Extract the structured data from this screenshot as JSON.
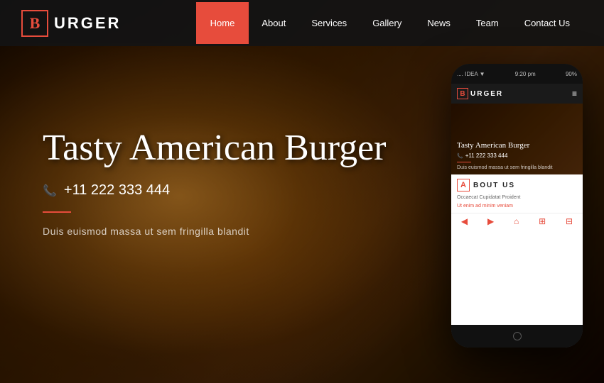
{
  "brand": {
    "letter": "B",
    "name": "URGER",
    "full_name": "BURGER"
  },
  "navbar": {
    "items": [
      {
        "label": "Home",
        "active": true
      },
      {
        "label": "About",
        "active": false
      },
      {
        "label": "Services",
        "active": false
      },
      {
        "label": "Gallery",
        "active": false
      },
      {
        "label": "News",
        "active": false
      },
      {
        "label": "Team",
        "active": false
      },
      {
        "label": "Contact Us",
        "active": false
      }
    ]
  },
  "hero": {
    "title": "Tasty American Burger",
    "phone_icon": "📞",
    "phone_number": "+11 222 333 444",
    "subtitle": "Duis euismod massa ut sem fringilla blandit"
  },
  "phone_mockup": {
    "status_bar": {
      "left": ".... IDEA ▼",
      "time": "9:20 pm",
      "right": "90%"
    },
    "nav": {
      "letter": "B",
      "name": "URGER",
      "hamburger_icon": "≡"
    },
    "hero": {
      "title": "Tasty American Burger",
      "phone_number": "+11 222 333 444",
      "subtitle": "Duis euismod massa ut sem fringilla blandit"
    },
    "about": {
      "letter": "A",
      "section_title": "BOUT US",
      "subtitle": "Occaecat Cupidatat Proident",
      "highlight": "Ut enim ad minim veniam"
    },
    "bottom_icons": [
      "◀",
      "▶",
      "⌂",
      "⊞",
      "⊟"
    ]
  },
  "colors": {
    "accent": "#e74c3c",
    "dark": "#1a1a1a",
    "white": "#ffffff"
  }
}
